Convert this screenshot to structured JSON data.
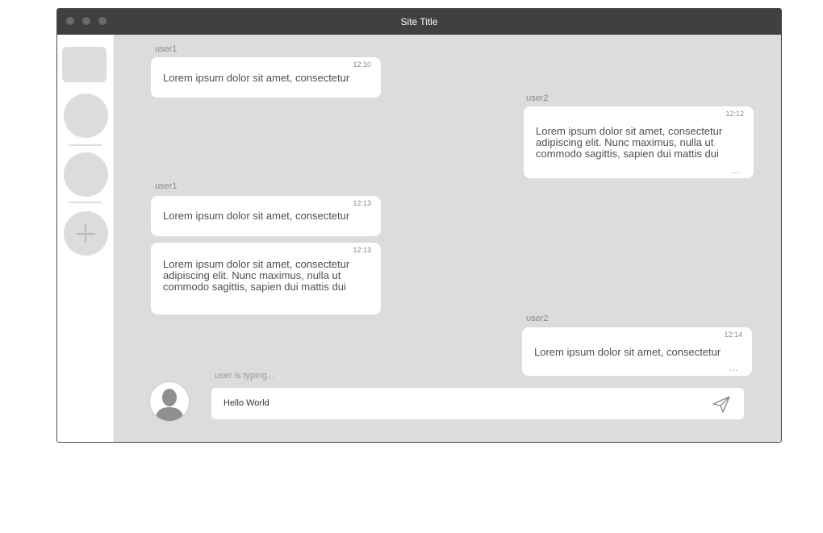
{
  "window": {
    "title": "Site Title"
  },
  "sidebar": {
    "items": [
      {
        "icon": "app-square-icon"
      },
      {
        "icon": "channel-circle-icon"
      },
      {
        "icon": "channel-circle-icon"
      },
      {
        "icon": "plus-icon"
      }
    ]
  },
  "messages": [
    {
      "user": "user1",
      "time": "12:10",
      "text": "Lorem ipsum dolor sit amet, consectetur"
    },
    {
      "user": "user2",
      "time": "12:12",
      "text": "Lorem ipsum dolor sit amet, consectetur adipiscing elit. Nunc maximus, nulla ut commodo sagittis, sapien dui mattis dui",
      "more": "…"
    },
    {
      "user": "user1",
      "time": "12:13",
      "text": "Lorem ipsum dolor sit amet, consectetur"
    },
    {
      "time": "12:13",
      "text": "Lorem ipsum dolor sit amet, consectetur adipiscing elit. Nunc maximus, nulla ut commodo sagittis, sapien dui mattis dui"
    },
    {
      "user": "user2",
      "time": "12:14",
      "text": "Lorem ipsum dolor sit amet, consectetur",
      "more": "…"
    }
  ],
  "composer": {
    "typing_status": "user is typing...",
    "value": "Hello World",
    "avatar_icon": "user-avatar-icon",
    "send_icon": "send-icon"
  },
  "colors": {
    "titlebar": "#404040",
    "chat_background": "#dcdcdc",
    "bubble": "#ffffff"
  }
}
